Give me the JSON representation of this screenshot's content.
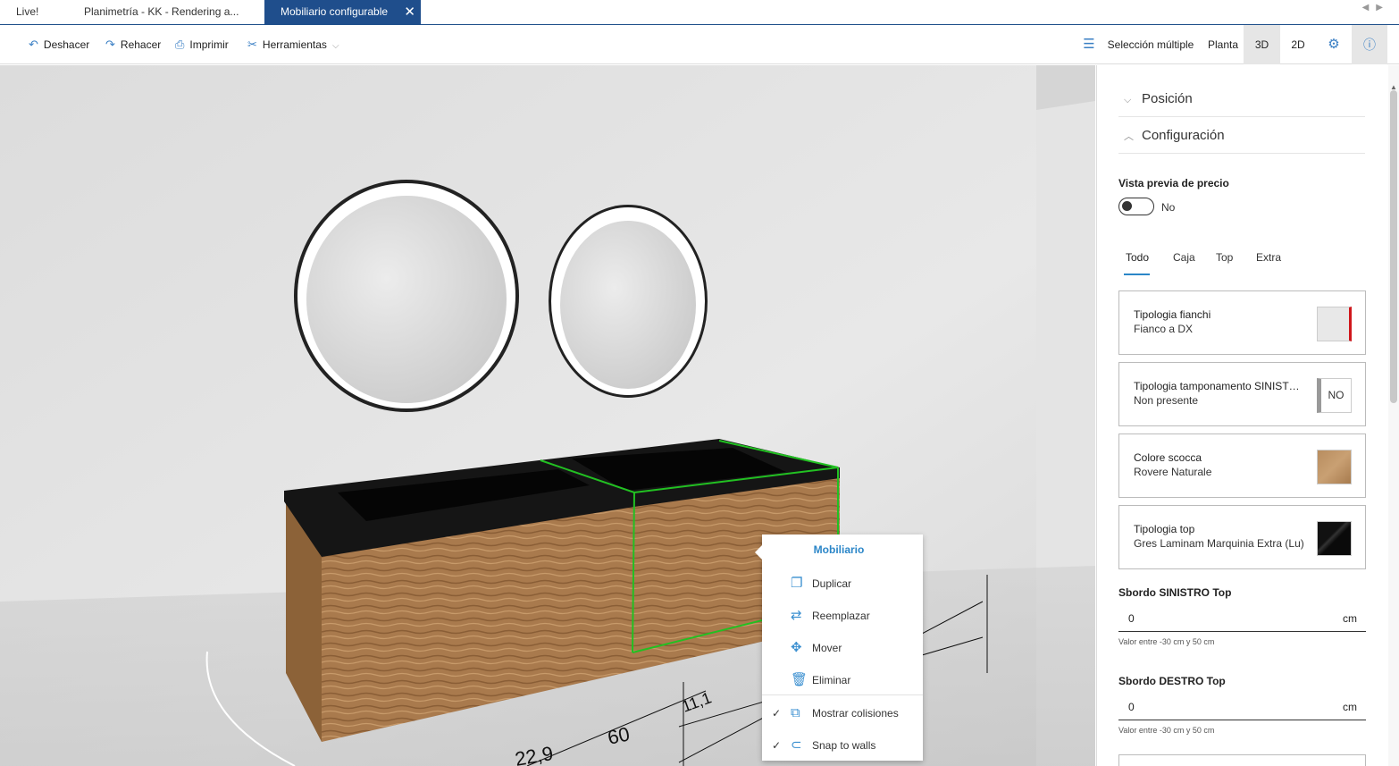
{
  "tabs": [
    {
      "label": "Live!"
    },
    {
      "label": "Planimetría - KK - Rendering a..."
    },
    {
      "label": "Mobiliario configurable",
      "close": "✕"
    }
  ],
  "toolbar": {
    "undo": "Deshacer",
    "redo": "Rehacer",
    "print": "Imprimir",
    "tools": "Herramientas",
    "multi_select": "Selección múltiple",
    "plan": "Planta",
    "view3d": "3D",
    "view2d": "2D"
  },
  "scene": {
    "dimensions": [
      "60",
      "11,1",
      "22,9"
    ]
  },
  "context_menu": {
    "title": "Mobiliario",
    "items": [
      {
        "label": "Duplicar",
        "icon": "copy-icon"
      },
      {
        "label": "Reemplazar",
        "icon": "swap-icon"
      },
      {
        "label": "Mover",
        "icon": "move-icon"
      },
      {
        "label": "Eliminar",
        "icon": "trash-icon"
      }
    ],
    "toggles": [
      {
        "label": "Mostrar colisiones",
        "checked": true
      },
      {
        "label": "Snap to walls",
        "checked": true
      }
    ]
  },
  "panel": {
    "sections": [
      {
        "label": "Posición",
        "expanded": false
      },
      {
        "label": "Configuración",
        "expanded": true
      }
    ],
    "price_preview": {
      "label": "Vista previa de precio",
      "value": "No"
    },
    "tabs": [
      {
        "label": "Todo",
        "active": true
      },
      {
        "label": "Caja"
      },
      {
        "label": "Top"
      },
      {
        "label": "Extra"
      }
    ],
    "cards": [
      {
        "title": "Tipologia fianchi",
        "value": "Fianco a DX"
      },
      {
        "title": "Tipologia tamponamento SINISTRO",
        "value": "Non presente",
        "badge": "NO"
      },
      {
        "title": "Colore scocca",
        "value": "Rovere Naturale"
      },
      {
        "title": "Tipologia top",
        "value": "Gres Laminam Marquinia Extra (Lu)"
      }
    ],
    "fields": [
      {
        "label": "Sbordo SINISTRO Top",
        "value": "0",
        "unit": "cm",
        "hint": "Valor entre -30 cm y 50 cm"
      },
      {
        "label": "Sbordo DESTRO Top",
        "value": "0",
        "unit": "cm",
        "hint": "Valor entre -30 cm y 50 cm"
      }
    ]
  },
  "colors": {
    "accent": "#2b86c8",
    "tab_active": "#1f4e8c",
    "selection": "#22c022",
    "wood": "#a97a4d",
    "top": "#151515"
  }
}
